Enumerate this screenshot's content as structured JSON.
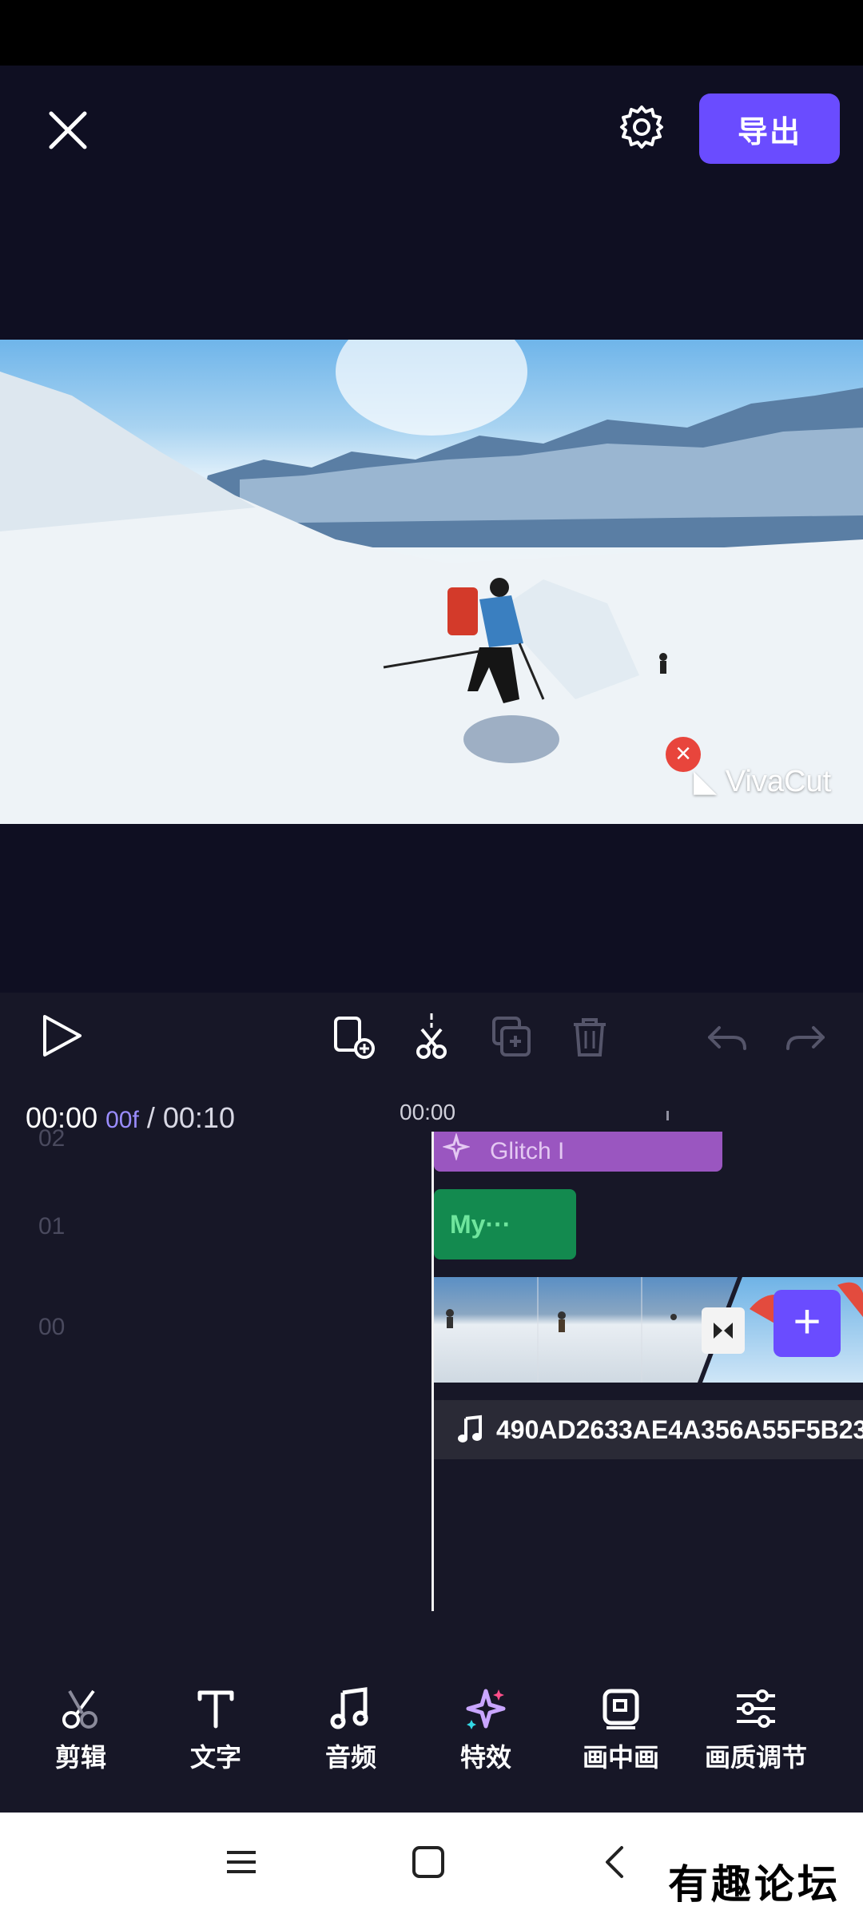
{
  "header": {
    "export_label": "导出"
  },
  "preview": {
    "watermark_text": "VivaCut",
    "watermark_close": "×"
  },
  "timeline": {
    "current_time": "00:00",
    "current_frame": "00f",
    "separator": "/",
    "total_time": "00:10",
    "ruler_time": "00:00",
    "tracks": [
      {
        "index": "02"
      },
      {
        "index": "01"
      },
      {
        "index": "00"
      }
    ],
    "effect_clip_label": "Glitch I",
    "text_clip_label": "My···",
    "add_label": "+",
    "audio_clip_name": "490AD2633AE4A356A55F5B23"
  },
  "bottom_toolbar": [
    {
      "label": "剪辑",
      "icon": "scissors-icon"
    },
    {
      "label": "文字",
      "icon": "text-icon"
    },
    {
      "label": "音频",
      "icon": "music-note-icon"
    },
    {
      "label": "特效",
      "icon": "sparkle-icon"
    },
    {
      "label": "画中画",
      "icon": "picture-in-picture-icon"
    },
    {
      "label": "画质调节",
      "icon": "sliders-icon"
    }
  ],
  "forum_logo": "有趣论坛",
  "colors": {
    "accent": "#6a4cff",
    "effect_clip": "#9a56c0",
    "text_clip": "#138a4f",
    "background": "#10101f"
  }
}
